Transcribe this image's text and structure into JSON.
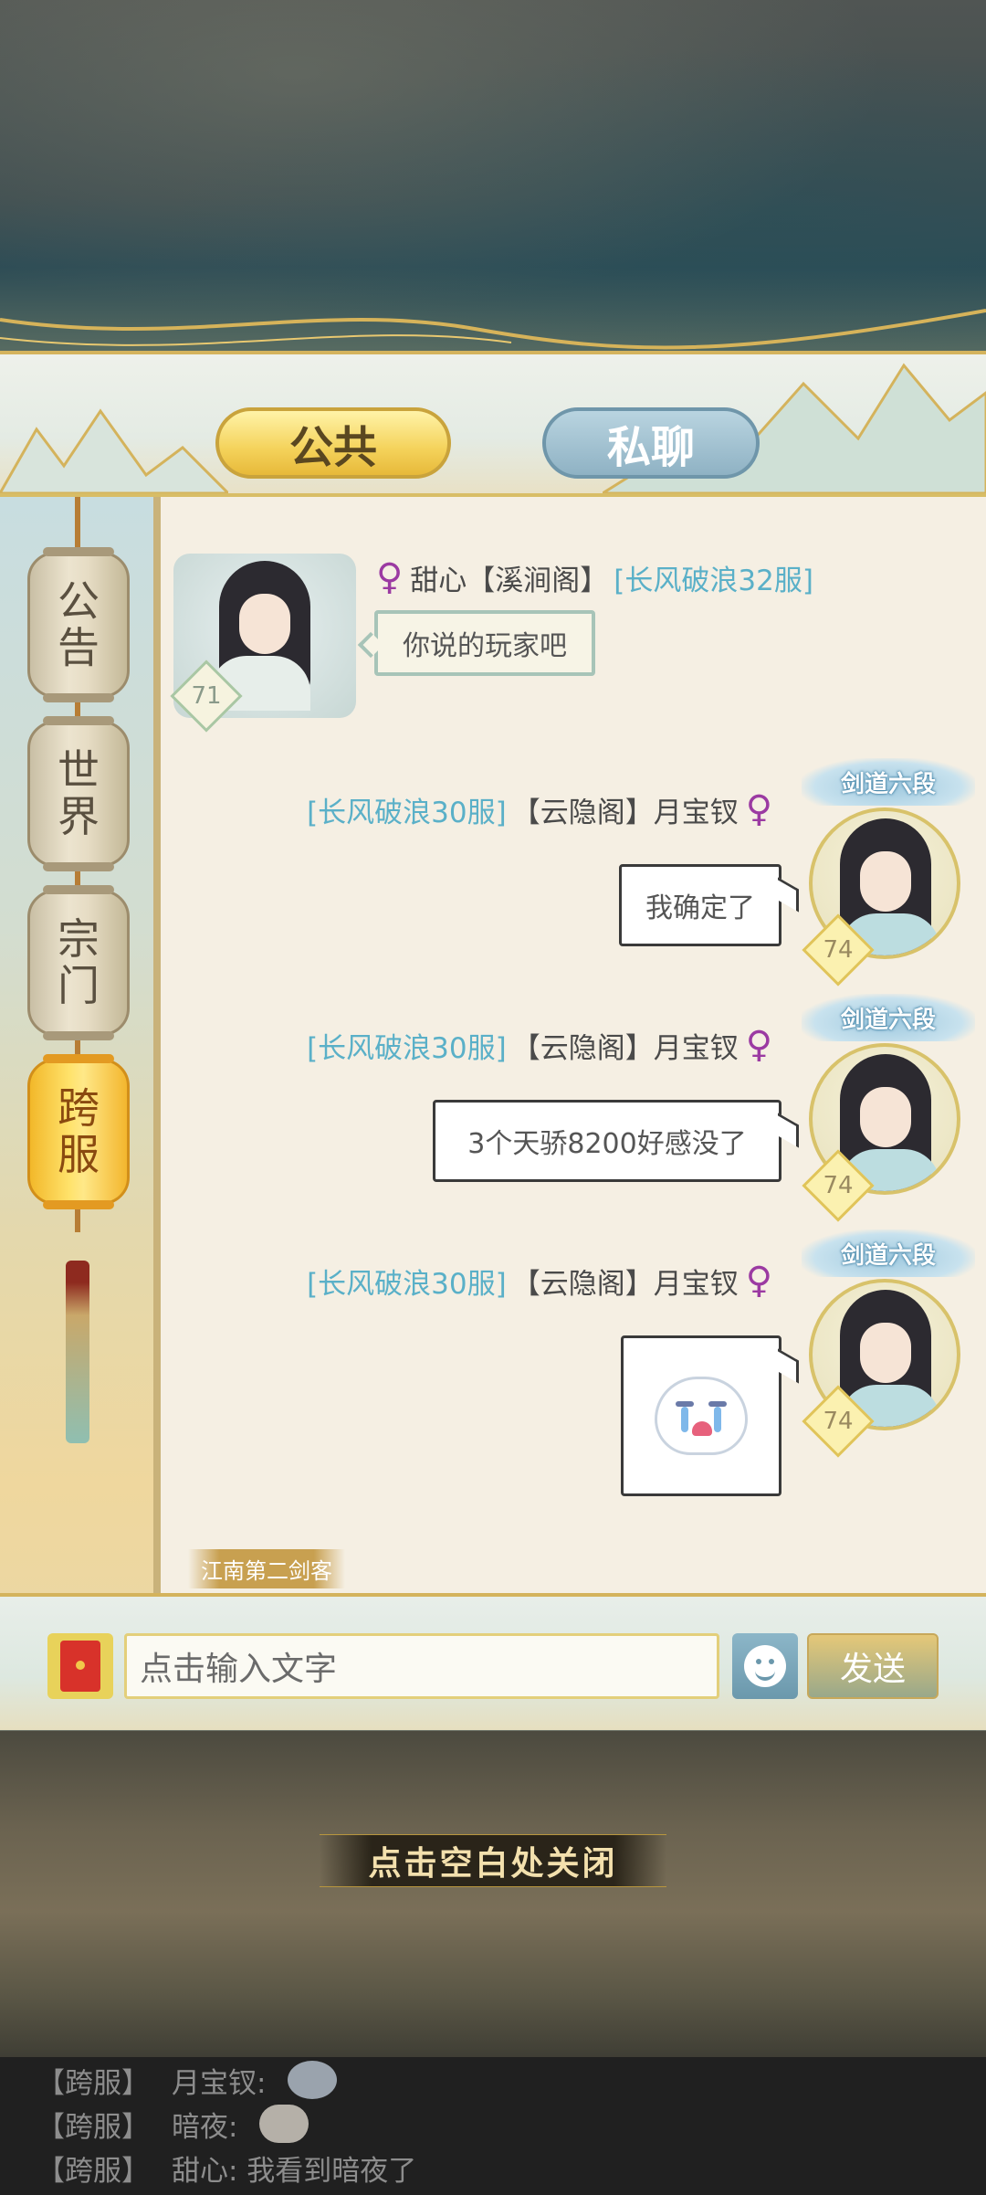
{
  "tabs": [
    {
      "label": "公共",
      "active": true
    },
    {
      "label": "私聊",
      "active": false
    }
  ],
  "sidebar": {
    "items": [
      {
        "label": "公\n告",
        "active": false
      },
      {
        "label": "世\n界",
        "active": false
      },
      {
        "label": "宗\n门",
        "active": false
      },
      {
        "label": "跨\n服",
        "active": true
      }
    ]
  },
  "messages": [
    {
      "side": "left",
      "server": "[长风破浪32服]",
      "guild": "【溪涧阁】",
      "name": "甜心",
      "level": "71",
      "text": "你说的玩家吧"
    },
    {
      "side": "right",
      "server": "[长风破浪30服]",
      "guild": "【云隐阁】",
      "name": "月宝钗",
      "level": "74",
      "title": "剑道六段",
      "text": "我确定了"
    },
    {
      "side": "right",
      "server": "[长风破浪30服]",
      "guild": "【云隐阁】",
      "name": "月宝钗",
      "level": "74",
      "title": "剑道六段",
      "text": "3个天骄8200好感没了"
    },
    {
      "side": "right",
      "server": "[长风破浪30服]",
      "guild": "【云隐阁】",
      "name": "月宝钗",
      "level": "74",
      "title": "剑道六段",
      "sticker": "crying-face-icon"
    }
  ],
  "stamp": "江南第二剑客",
  "input": {
    "placeholder": "点击输入文字",
    "send_label": "发送"
  },
  "close_hint": "点击空白处关闭",
  "ticker": [
    {
      "channel": "【跨服】",
      "text": "月宝钗:",
      "sticker": "crying-face-icon"
    },
    {
      "channel": "【跨服】",
      "text": "暗夜:",
      "sticker": "seal-sticker-icon"
    },
    {
      "channel": "【跨服】",
      "text": "甜心: 我看到暗夜了"
    }
  ],
  "colors": {
    "server_text": "#5ab0c8",
    "female_symbol": "#9b3aa2",
    "active_tab": "#f4d25a",
    "inactive_tab": "#8fb2c4"
  }
}
